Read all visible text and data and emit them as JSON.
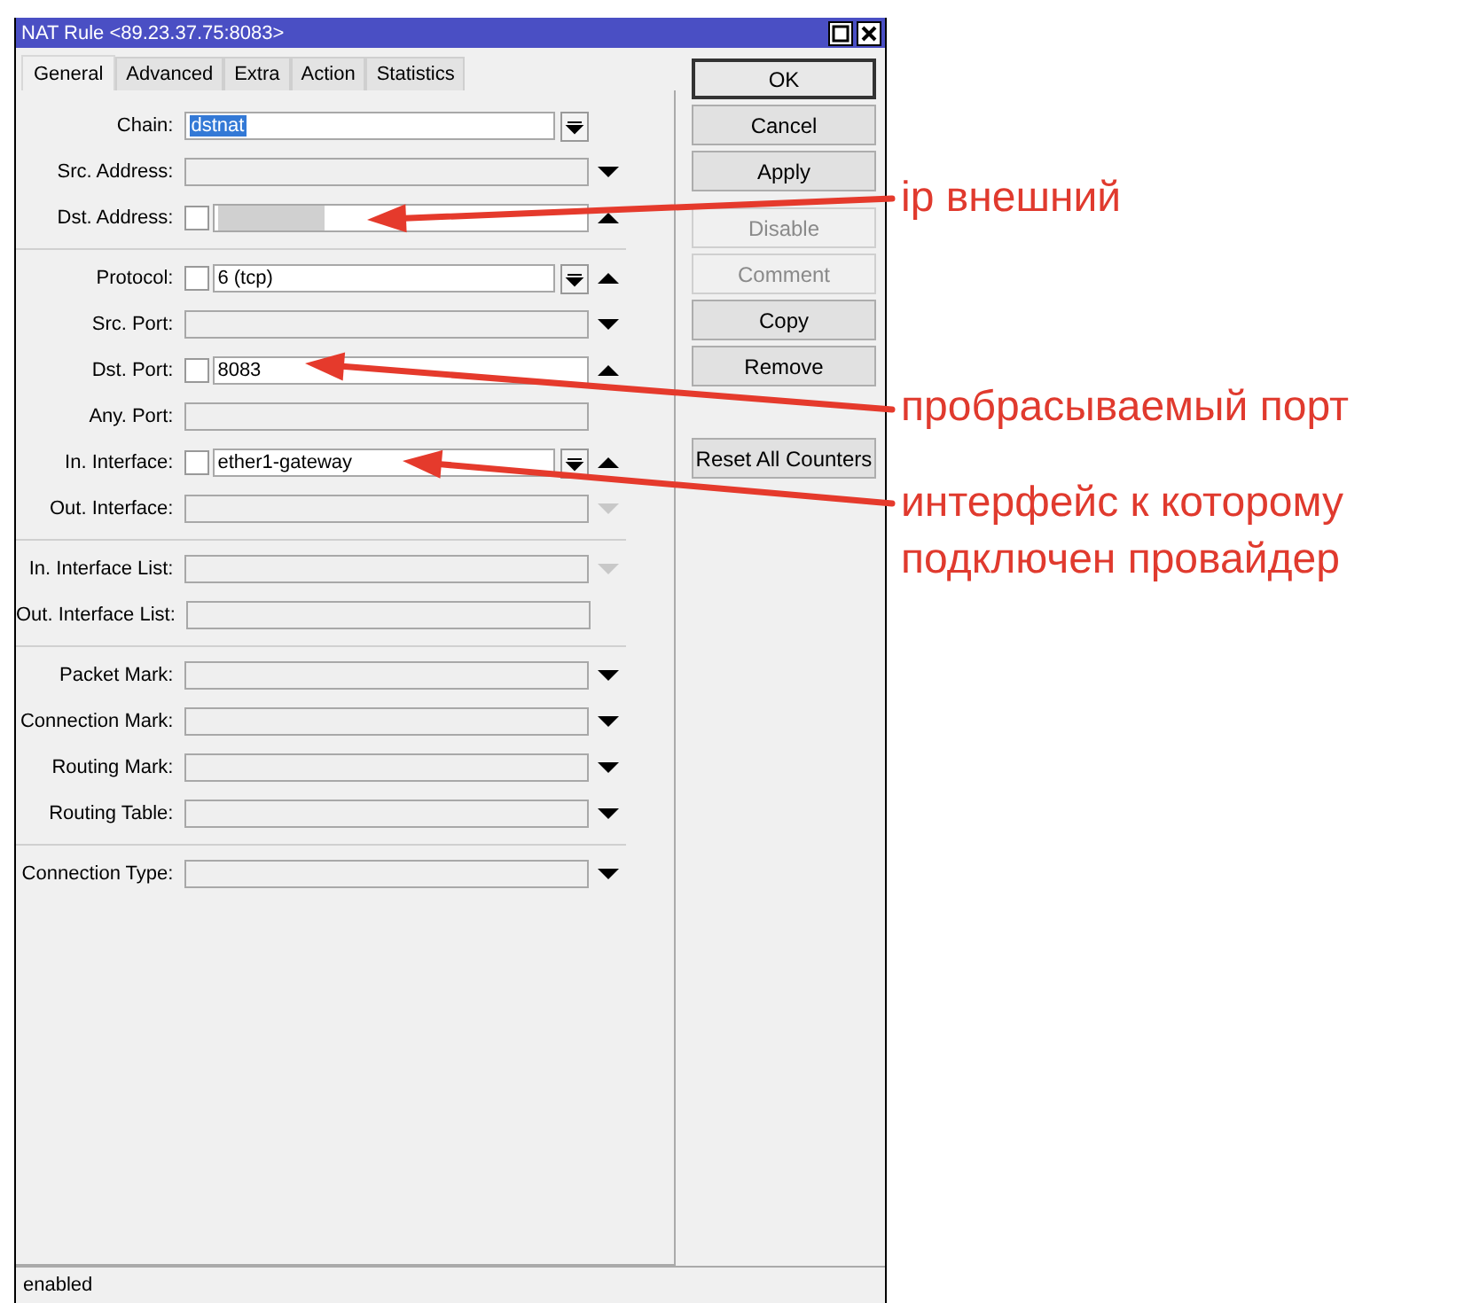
{
  "window": {
    "title": "NAT Rule <89.23.37.75:8083>"
  },
  "tabs": [
    {
      "label": "General",
      "selected": true
    },
    {
      "label": "Advanced",
      "selected": false
    },
    {
      "label": "Extra",
      "selected": false
    },
    {
      "label": "Action",
      "selected": false
    },
    {
      "label": "Statistics",
      "selected": false
    }
  ],
  "field_groups": [
    [
      {
        "label": "Chain:",
        "value": "dstnat",
        "value_selected": true,
        "kind": "combo"
      },
      {
        "label": "Src. Address:",
        "kind": "text",
        "arrow_down": true
      },
      {
        "label": "Dst. Address:",
        "redacted": true,
        "checked": false,
        "kind": "text",
        "arrow_up": true
      }
    ],
    [
      {
        "label": "Protocol:",
        "value": "6 (tcp)",
        "checked": false,
        "kind": "combo",
        "arrow_up": true
      },
      {
        "label": "Src. Port:",
        "kind": "text",
        "arrow_down": true
      },
      {
        "label": "Dst. Port:",
        "value": "8083",
        "checked": false,
        "kind": "text",
        "arrow_up": true
      },
      {
        "label": "Any. Port:",
        "kind": "text"
      },
      {
        "label": "In. Interface:",
        "value": "ether1-gateway",
        "checked": false,
        "kind": "combo",
        "arrow_up": true
      },
      {
        "label": "Out. Interface:",
        "kind": "text",
        "arrow_down": true,
        "arrow_dim": true
      }
    ],
    [
      {
        "label": "In. Interface List:",
        "kind": "text",
        "arrow_down": true,
        "arrow_dim": true
      },
      {
        "label": "Out. Interface List:",
        "kind": "text"
      }
    ],
    [
      {
        "label": "Packet Mark:",
        "kind": "text",
        "arrow_down": true
      },
      {
        "label": "Connection Mark:",
        "kind": "text",
        "arrow_down": true
      },
      {
        "label": "Routing Mark:",
        "kind": "text",
        "arrow_down": true
      },
      {
        "label": "Routing Table:",
        "kind": "text",
        "arrow_down": true
      }
    ],
    [
      {
        "label": "Connection Type:",
        "kind": "text",
        "arrow_down": true
      }
    ]
  ],
  "button_groups": [
    [
      {
        "label": "OK",
        "default": true,
        "disabled": false
      },
      {
        "label": "Cancel",
        "default": false,
        "disabled": false
      },
      {
        "label": "Apply",
        "default": false,
        "disabled": false
      }
    ],
    [
      {
        "label": "Disable",
        "default": false,
        "disabled": true
      },
      {
        "label": "Comment",
        "default": false,
        "disabled": true
      },
      {
        "label": "Copy",
        "default": false,
        "disabled": false
      },
      {
        "label": "Remove",
        "default": false,
        "disabled": false
      }
    ],
    [
      {
        "label": "Reset All Counters",
        "default": false,
        "disabled": false
      }
    ]
  ],
  "status_bar": {
    "text": "enabled"
  },
  "annotations": [
    {
      "text": "ip внешний"
    },
    {
      "text": "пробрасываемый порт"
    },
    {
      "text": "интерфейс к которому подключен провайдер"
    }
  ]
}
